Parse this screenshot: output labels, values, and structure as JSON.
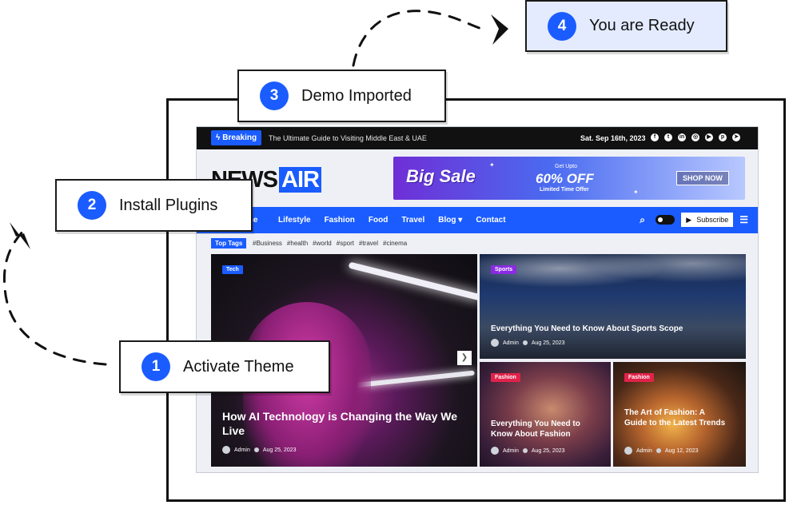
{
  "steps": [
    {
      "number": "1",
      "label": "Activate Theme"
    },
    {
      "number": "2",
      "label": "Install Plugins"
    },
    {
      "number": "3",
      "label": "Demo Imported"
    },
    {
      "number": "4",
      "label": "You are Ready"
    }
  ],
  "site": {
    "topbar": {
      "breaking_label": "Breaking",
      "ticker": "The Ultimate Guide to Visiting Middle East & UAE",
      "date": "Sat. Sep 16th, 2023",
      "socials": [
        "facebook-icon",
        "twitter-icon",
        "linkedin-icon",
        "instagram-icon",
        "youtube-icon",
        "pinterest-icon",
        "telegram-icon"
      ]
    },
    "logo": {
      "part1": "NEWS",
      "part2": "AIR"
    },
    "ad": {
      "headline": "Big Sale",
      "upto": "Get Upto",
      "offer": "60% OFF",
      "limited": "Limited Time Offer",
      "cta": "SHOP NOW"
    },
    "nav": {
      "home": "me",
      "items": [
        "Lifestyle",
        "Fashion",
        "Food",
        "Travel",
        "Blog",
        "Contact"
      ],
      "subscribe": "Subscribe"
    },
    "tags": {
      "label": "Top Tags",
      "items": [
        "#Business",
        "#health",
        "#world",
        "#sport",
        "#travel",
        "#cinema"
      ]
    },
    "posts": [
      {
        "category": "Tech",
        "title": "How AI Technology is Changing the Way We Live",
        "author": "Admin",
        "date": "Aug 25, 2023"
      },
      {
        "category": "Sports",
        "title": "Everything You Need to Know About Sports Scope",
        "author": "Admin",
        "date": "Aug 25, 2023"
      },
      {
        "category": "Fashion",
        "title": "Everything You Need to Know About Fashion",
        "author": "Admin",
        "date": "Aug 25, 2023"
      },
      {
        "category": "Fashion",
        "title": "The Art of Fashion: A Guide to the Latest Trends",
        "author": "Admin",
        "date": "Aug 12, 2023"
      }
    ]
  },
  "colors": {
    "accent": "#1a5cff",
    "topbar": "#111111",
    "fashion": "#e0224a",
    "sports": "#8a2be2"
  }
}
